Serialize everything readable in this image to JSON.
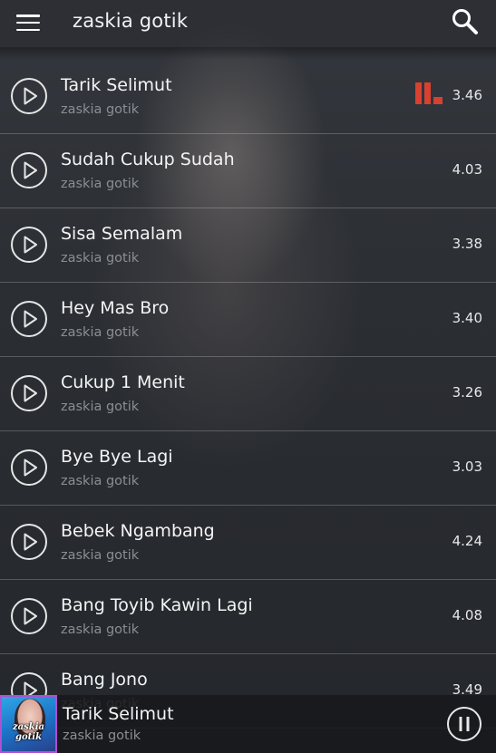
{
  "header": {
    "title": "zaskia gotik",
    "menu_icon": "hamburger-menu-icon",
    "search_icon": "search-icon"
  },
  "songs": [
    {
      "title": "Tarik Selimut",
      "artist": "zaskia gotik",
      "duration": "3.46",
      "playing": true
    },
    {
      "title": "Sudah Cukup Sudah",
      "artist": "zaskia gotik",
      "duration": "4.03",
      "playing": false
    },
    {
      "title": "Sisa Semalam",
      "artist": "zaskia gotik",
      "duration": "3.38",
      "playing": false
    },
    {
      "title": "Hey Mas Bro",
      "artist": "zaskia gotik",
      "duration": "3.40",
      "playing": false
    },
    {
      "title": "Cukup 1 Menit",
      "artist": "zaskia gotik",
      "duration": "3.26",
      "playing": false
    },
    {
      "title": "Bye Bye Lagi",
      "artist": "zaskia gotik",
      "duration": "3.03",
      "playing": false
    },
    {
      "title": "Bebek Ngambang",
      "artist": "zaskia gotik",
      "duration": "4.24",
      "playing": false
    },
    {
      "title": "Bang Toyib Kawin Lagi",
      "artist": "zaskia gotik",
      "duration": "4.08",
      "playing": false
    },
    {
      "title": "Bang Jono",
      "artist": "zaskia gotik",
      "duration": "3.49",
      "playing": false
    }
  ],
  "now_playing": {
    "title": "Tarik Selimut",
    "artist": "zaskia gotik",
    "cover_text": "zaskia gotik",
    "pause_icon": "pause-icon"
  },
  "colors": {
    "equalizer": "#d8402f",
    "cover_border": "#b04fd0"
  }
}
